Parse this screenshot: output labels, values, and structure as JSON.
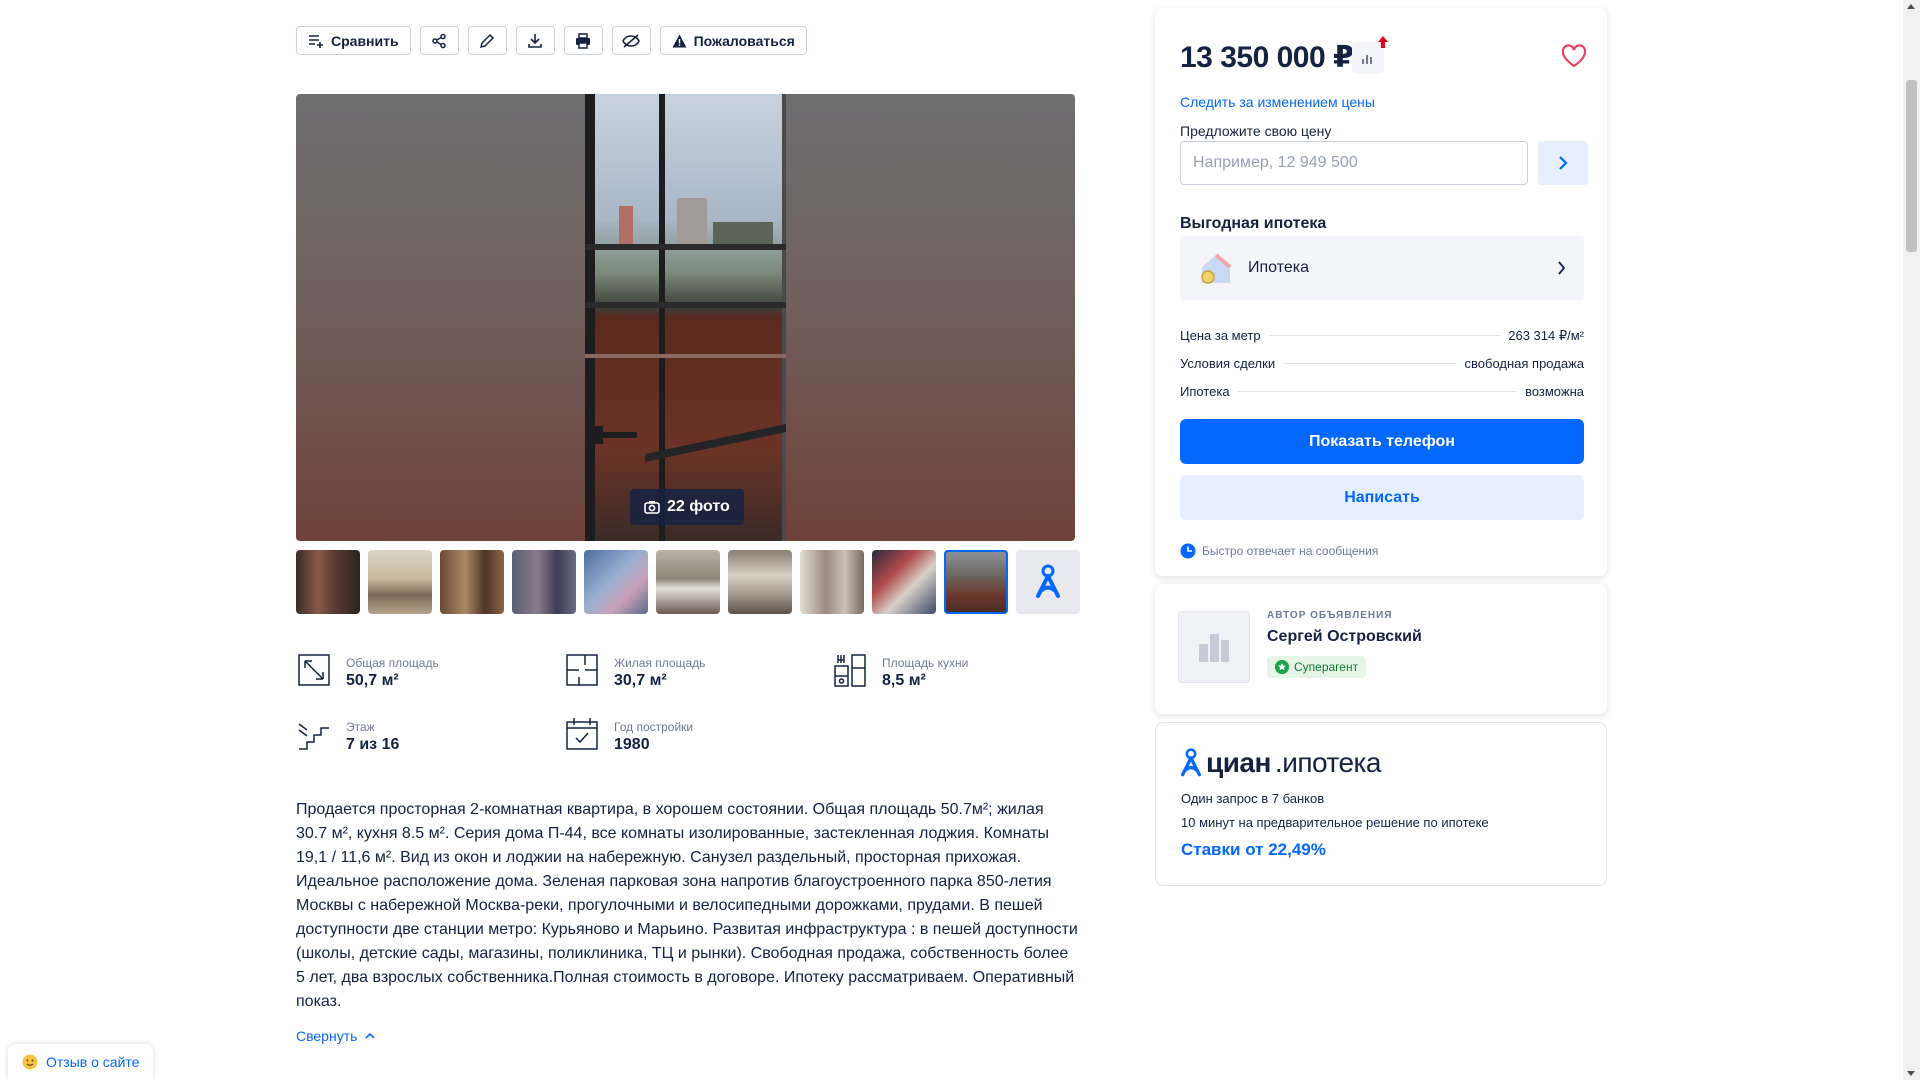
{
  "toolbar": {
    "compare_label": "Сравнить",
    "report_label": "Пожаловаться",
    "icons": [
      "compare-icon",
      "share-icon",
      "edit-icon",
      "download-icon",
      "print-icon",
      "hide-icon",
      "warning-icon"
    ]
  },
  "gallery": {
    "photo_count": "22 фото",
    "thumb_count": 10
  },
  "features": [
    {
      "label": "Общая площадь",
      "value": "50,7 м²",
      "icon": "area-icon"
    },
    {
      "label": "Жилая площадь",
      "value": "30,7 м²",
      "icon": "living-area-icon"
    },
    {
      "label": "Площадь кухни",
      "value": "8,5 м²",
      "icon": "kitchen-icon"
    },
    {
      "label": "Этаж",
      "value": "7 из 16",
      "icon": "stairs-icon"
    },
    {
      "label": "Год постройки",
      "value": "1980",
      "icon": "calendar-icon"
    }
  ],
  "description": {
    "text": "Продается просторная 2-комнатная квартира, в хорошем состоянии. Общая площадь 50.7м²; жилая 30.7 м², кухня 8.5 м². Серия дома П-44, все комнаты изолированные, застекленная лоджия. Комнаты 19,1 / 11,6 м². Вид   из окон и лоджии  на набережную. Санузел раздельный, просторная прихожая. Идеальное расположение дома. Зеленая парковая зона напротив благоустроенного парка 850-летия Москвы с набережной Москва-реки, прогулочными и велосипедными дорожками, прудами.  В пешей доступности две станции метро: Курьяново и Марьино. Развитая  инфраструктура : в пешей доступности (школы, детские сады, магазины, поликлиника, ТЦ и рынки). Свободная продажа, собственность более 5 лет, два взрослых собственника.Полная стоимость в договоре. Ипотеку рассматриваем. Оперативный показ.",
    "collapse_label": "Свернуть"
  },
  "price_card": {
    "price": "13 350 000 ₽",
    "track_link": "Следить за изменением цены",
    "offer_label": "Предложите свою цену",
    "offer_placeholder": "Например, 12 949 500",
    "mortgage_title": "Выгодная ипотека",
    "mortgage_item": "Ипотека",
    "facts": [
      {
        "key": "Цена за метр",
        "value": "263 314 ₽/м²"
      },
      {
        "key": "Условия сделки",
        "value": "свободная продажа"
      },
      {
        "key": "Ипотека",
        "value": "возможна"
      }
    ],
    "show_phone": "Показать телефон",
    "write": "Написать",
    "fast_reply": "Быстро отвечает на сообщения"
  },
  "author": {
    "caption": "АВТОР ОБЪЯВЛЕНИЯ",
    "name": "Сергей Островский",
    "badge": "Суперагент"
  },
  "ipoteka": {
    "brand": "циан",
    "brand_sub": ".ипотека",
    "line1": "Один запрос в 7 банков",
    "line2": "10 минут на предварительное решение по ипотеке",
    "rate": "Ставки от 22,49%"
  },
  "feedback": {
    "label": "Отзыв о сайте"
  },
  "colors": {
    "accent": "#0468ff",
    "text": "#152242",
    "muted": "#707a95",
    "favorite": "#e84260",
    "superagent": "#0f7a2d"
  }
}
